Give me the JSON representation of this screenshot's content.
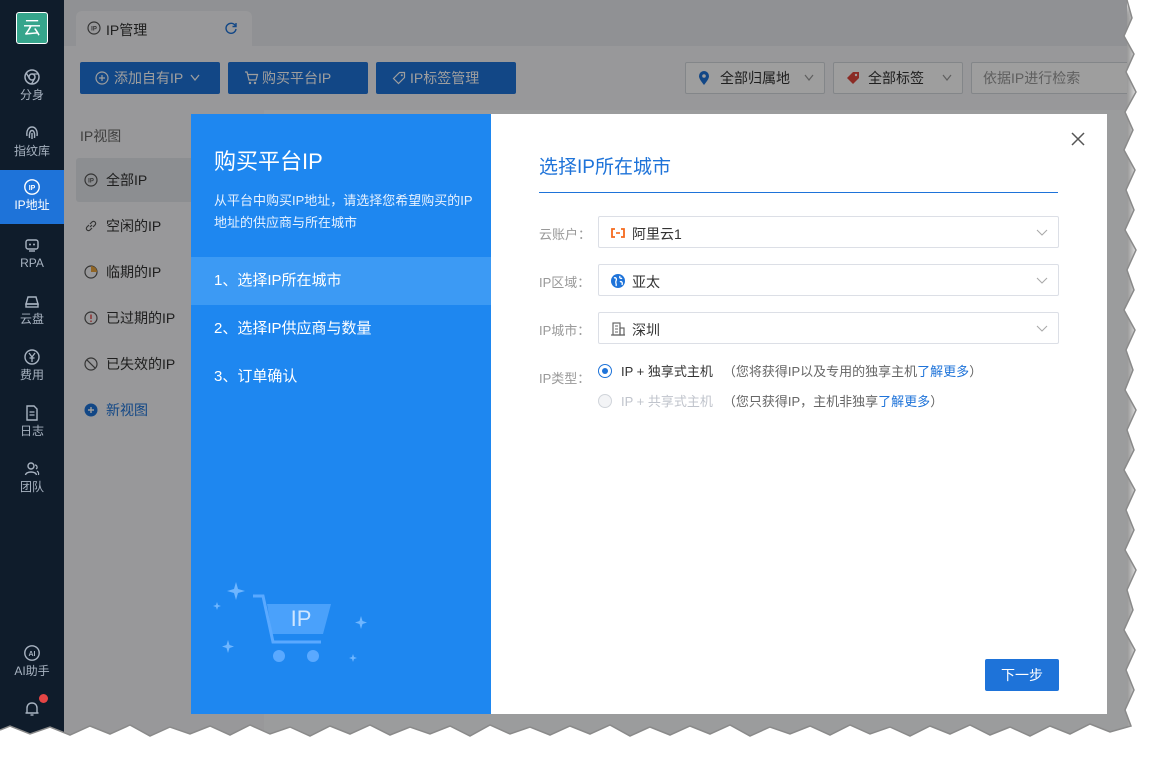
{
  "app": {
    "logo_text": "云",
    "nav": [
      {
        "label": "分身",
        "icon": "chrome-icon"
      },
      {
        "label": "指纹库",
        "icon": "fingerprint-icon"
      },
      {
        "label": "IP地址",
        "icon": "ip-icon"
      },
      {
        "label": "RPA",
        "icon": "robot-icon"
      },
      {
        "label": "云盘",
        "icon": "cloud-drive-icon"
      },
      {
        "label": "费用",
        "icon": "yen-icon"
      },
      {
        "label": "日志",
        "icon": "log-icon"
      },
      {
        "label": "团队",
        "icon": "team-icon"
      }
    ],
    "ai_label": "AI助手",
    "ai_icon_text": "AI"
  },
  "tabs": {
    "active_tab": "IP管理"
  },
  "toolbar": {
    "add_own_ip": "添加自有IP",
    "buy_platform_ip": "购买平台IP",
    "ip_tag_manage": "IP标签管理",
    "filter_region": "全部归属地",
    "filter_tags": "全部标签",
    "search_placeholder": "依据IP进行检索"
  },
  "side": {
    "title": "IP视图",
    "items": [
      {
        "label": "全部IP"
      },
      {
        "label": "空闲的IP"
      },
      {
        "label": "临期的IP"
      },
      {
        "label": "已过期的IP"
      },
      {
        "label": "已失效的IP"
      }
    ],
    "new_view": "新视图"
  },
  "dialog": {
    "title": "购买平台IP",
    "description": "从平台中购买IP地址，请选择您希望购买的IP地址的供应商与所在城市",
    "steps": [
      "1、选择IP所在城市",
      "2、选择IP供应商与数量",
      "3、订单确认"
    ],
    "illustration_text": "IP",
    "section_title": "选择IP所在城市",
    "fields": {
      "cloud_account": {
        "label": "云账户",
        "value": "阿里云1"
      },
      "ip_region": {
        "label": "IP区域",
        "value": "亚太"
      },
      "ip_city": {
        "label": "IP城市",
        "value": "深圳"
      }
    },
    "ip_type": {
      "label": "IP类型",
      "options": [
        {
          "label": "IP + 独享式主机",
          "note": "（您将获得IP以及专用的独享主机",
          "link": "了解更多",
          "close": "）",
          "selected": true,
          "disabled": false
        },
        {
          "label": "IP + 共享式主机",
          "note": "（您只获得IP，主机非独享",
          "link": "了解更多",
          "close": "）",
          "selected": false,
          "disabled": true
        }
      ]
    },
    "next_button": "下一步"
  },
  "colors": {
    "primary": "#1e73d9",
    "dialog_panel": "#1e87f0",
    "nav_bg": "#0f1c2b",
    "logo_green": "#36a58c",
    "alert_red": "#e54545"
  }
}
